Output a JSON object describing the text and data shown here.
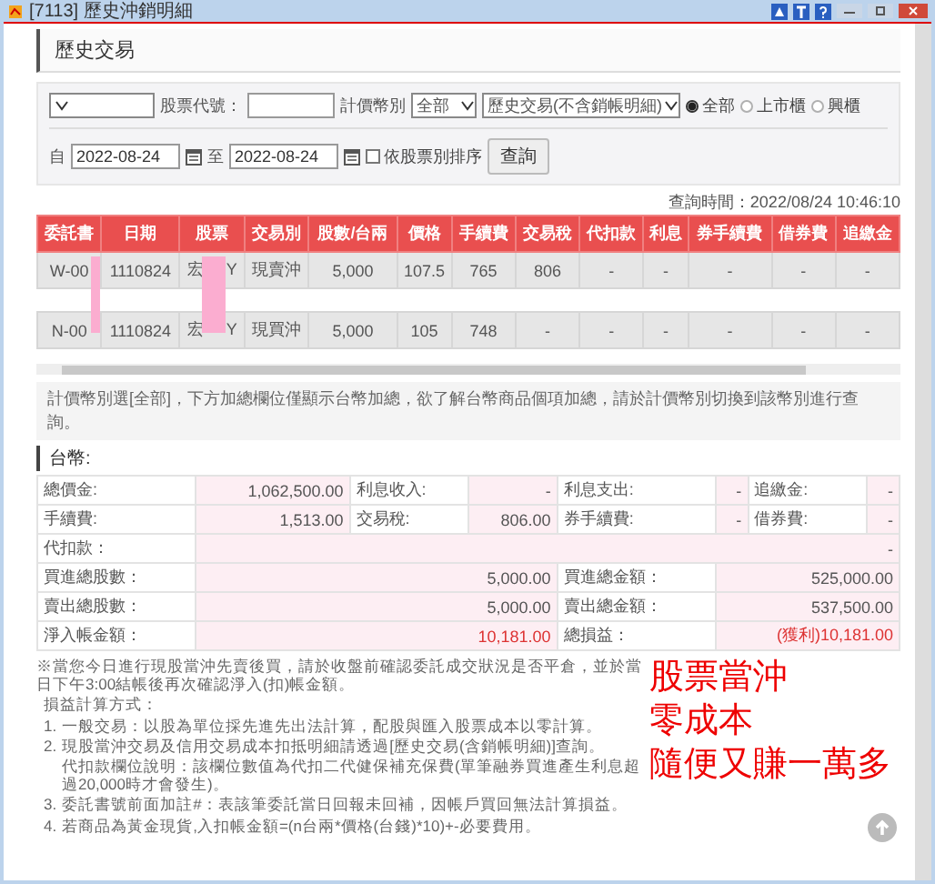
{
  "window": {
    "title": "[7113] 歷史沖銷明細"
  },
  "section_title": "歷史交易",
  "filters": {
    "stock_label": "股票代號：",
    "currency_label": "計價幣別",
    "currency_select": {
      "value": "全部"
    },
    "type_select": {
      "value": "歷史交易(不含銷帳明細)"
    },
    "markets": [
      {
        "label": "全部",
        "selected": true
      },
      {
        "label": "上市櫃",
        "selected": false
      },
      {
        "label": "興櫃",
        "selected": false
      }
    ],
    "from_label": "自",
    "from_date": "2022-08-24",
    "to_label": "至",
    "to_date": "2022-08-24",
    "sort_by_stock": {
      "label": "依股票別排序",
      "checked": false
    },
    "query_button": "查詢"
  },
  "query_time": "查詢時間：2022/08/24 10:46:10",
  "table": {
    "columns": [
      "委託書",
      "日期",
      "股票",
      "交易別",
      "股數/台兩",
      "價格",
      "手續費",
      "交易稅",
      "代扣款",
      "利息",
      "券手續費",
      "借券費",
      "追繳金"
    ],
    "rows": [
      [
        "W-00",
        "1110824",
        "宏 Y",
        "現賣沖",
        "5,000",
        "107.5",
        "765",
        "806",
        "-",
        "-",
        "-",
        "-",
        "-"
      ],
      [
        "N-00",
        "1110824",
        "宏 Y",
        "現買沖",
        "5,000",
        "105",
        "748",
        "-",
        "-",
        "-",
        "-",
        "-",
        "-"
      ]
    ]
  },
  "currency_note": "計價幣別選[全部]，下方加總欄位僅顯示台幣加總，欲了解台幣商品個項加總，請於計價幣別切換到該幣別進行查詢。",
  "summary": {
    "heading": "台幣:",
    "rows": [
      {
        "emphasis": false,
        "cells": [
          {
            "label": "總價金:",
            "value": "1,062,500.00"
          },
          {
            "label": "利息收入:",
            "value": "-"
          },
          {
            "label": "利息支出:",
            "value": "-"
          },
          {
            "label": "追繳金:",
            "value": "-"
          }
        ]
      },
      {
        "emphasis": false,
        "cells": [
          {
            "label": "手續費:",
            "value": "1,513.00"
          },
          {
            "label": "交易稅:",
            "value": "806.00"
          },
          {
            "label": "券手續費:",
            "value": "-"
          },
          {
            "label": "借券費:",
            "value": "-"
          }
        ]
      },
      {
        "emphasis": false,
        "cells": [
          {
            "label": "代扣款：",
            "value": "-"
          }
        ]
      },
      {
        "emphasis": false,
        "cells": [
          {
            "label": "買進總股數：",
            "value": "5,000.00"
          },
          {
            "label": "買進總金額：",
            "value": "525,000.00"
          }
        ]
      },
      {
        "emphasis": false,
        "cells": [
          {
            "label": "賣出總股數：",
            "value": "5,000.00"
          },
          {
            "label": "賣出總金額：",
            "value": "537,500.00"
          }
        ]
      },
      {
        "emphasis": true,
        "cells": [
          {
            "label": "淨入帳金額：",
            "value": "10,181.00"
          },
          {
            "label": "總損益：",
            "value": "(獲利)10,181.00"
          }
        ]
      }
    ]
  },
  "notes": {
    "warning": "※當您今日進行現股當沖先賣後買，請於收盤前確認委託成交狀況是否平倉，並於當日下午3:00結帳後再次確認淨入(扣)帳金額。",
    "heading": "損益計算方式：",
    "items": [
      {
        "number": "1.",
        "text": "一般交易：以股為單位採先進先出法計算，配股與匯入股票成本以零計算。"
      },
      {
        "number": "2.",
        "text": "現股當沖交易及信用交易成本扣抵明細請透過[歷史交易(含銷帳明細)]查詢。",
        "extra": "代扣款欄位說明：該欄位數值為代扣二代健保補充保費(單筆融券買進產生利息超過20,000時才會發生)。"
      },
      {
        "number": "3.",
        "text": "委託書號前面加註#：表該筆委託當日回報未回補，因帳戶買回無法計算損益。"
      },
      {
        "number": "4.",
        "text": "若商品為黃金現貨,入扣帳金額=(n台兩*價格(台錢)*10)+-必要費用。"
      }
    ]
  },
  "handwriting": [
    "股票當沖",
    "零成本",
    "隨便又賺一萬多"
  ]
}
